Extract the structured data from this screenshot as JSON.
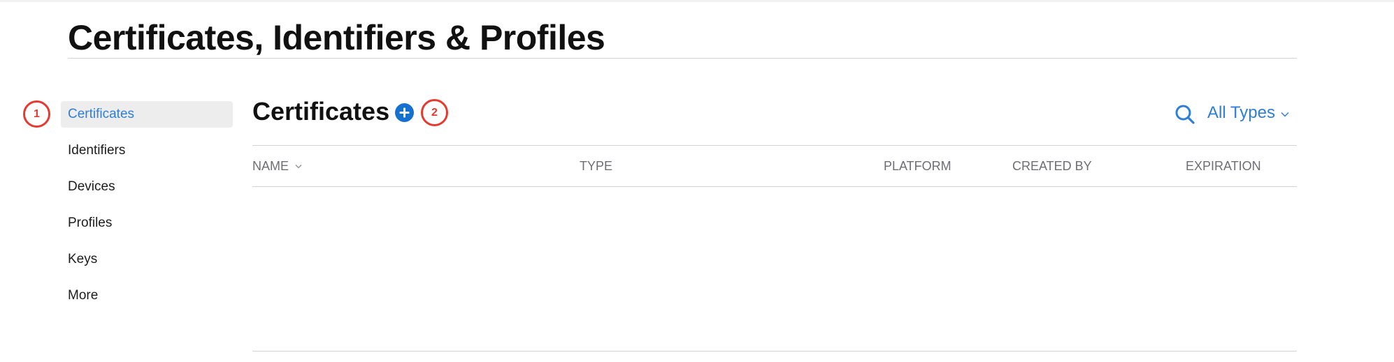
{
  "page": {
    "title": "Certificates, Identifiers & Profiles"
  },
  "sidebar": {
    "items": [
      {
        "label": "Certificates",
        "active": true
      },
      {
        "label": "Identifiers",
        "active": false
      },
      {
        "label": "Devices",
        "active": false
      },
      {
        "label": "Profiles",
        "active": false
      },
      {
        "label": "Keys",
        "active": false
      },
      {
        "label": "More",
        "active": false
      }
    ]
  },
  "callouts": [
    "1",
    "2"
  ],
  "main": {
    "section_title": "Certificates",
    "add_icon": "plus-circle-icon",
    "search_icon": "search-icon",
    "filter": {
      "label": "All Types",
      "icon": "chevron-down-icon"
    },
    "columns": [
      "NAME",
      "TYPE",
      "PLATFORM",
      "CREATED BY",
      "EXPIRATION"
    ],
    "sort_icon": "chevron-down-icon"
  },
  "colors": {
    "accent": "#2f7ed8",
    "add_button": "#1570cf",
    "callout": "#e53a2f",
    "active_bg": "#ededed"
  }
}
